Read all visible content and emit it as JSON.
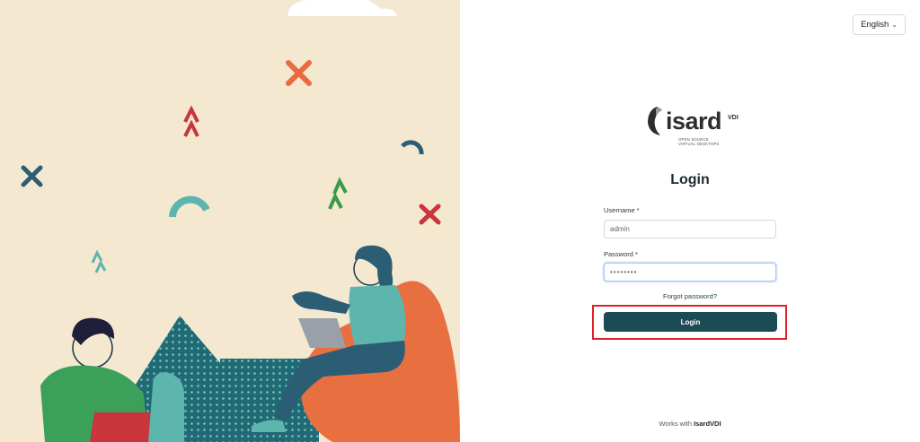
{
  "language": {
    "selected": "English",
    "icon": "chevron-down-icon"
  },
  "logo": {
    "word": "isard",
    "superscript": "VDI",
    "tagline_line1": "OPEN SOURCE",
    "tagline_line2": "VIRTUAL DESKTOPS"
  },
  "form": {
    "title": "Login",
    "username_label": "Username *",
    "username_value": "admin",
    "password_label": "Password *",
    "password_value": "••••••••",
    "forgot_link": "Forgot password?",
    "login_button": "Login"
  },
  "footer": {
    "prefix": "Works with",
    "brand": "IsardVDI"
  },
  "colors": {
    "accent": "#1c4a55",
    "highlight": "#e0202a",
    "illustration_bg": "#f4e8d1"
  }
}
